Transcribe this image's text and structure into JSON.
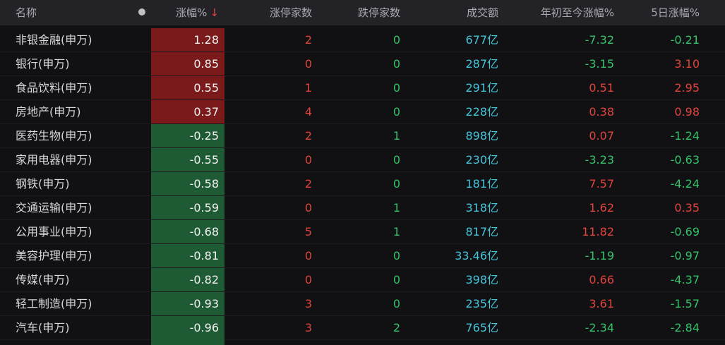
{
  "header": {
    "name": "名称",
    "pct": "涨幅%",
    "sort_arrow": "↓",
    "up_count": "涨停家数",
    "down_count": "跌停家数",
    "volume": "成交额",
    "ytd": "年初至今涨幅%",
    "five_day": "5日涨幅%"
  },
  "colors": {
    "up": "#e0443d",
    "down": "#35c26a",
    "volume": "#45c4da",
    "pos_cell_bg": "#7a1a1a",
    "neg_cell_bg": "#1e5a33"
  },
  "rows": [
    {
      "name": "非银金融(申万)",
      "pct": "1.28",
      "up": "2",
      "down": "0",
      "vol": "677亿",
      "ytd": "-7.32",
      "d5": "-0.21"
    },
    {
      "name": "银行(申万)",
      "pct": "0.85",
      "up": "0",
      "down": "0",
      "vol": "287亿",
      "ytd": "-3.15",
      "d5": "3.10"
    },
    {
      "name": "食品饮料(申万)",
      "pct": "0.55",
      "up": "1",
      "down": "0",
      "vol": "291亿",
      "ytd": "0.51",
      "d5": "2.95"
    },
    {
      "name": "房地产(申万)",
      "pct": "0.37",
      "up": "4",
      "down": "0",
      "vol": "228亿",
      "ytd": "0.38",
      "d5": "0.98"
    },
    {
      "name": "医药生物(申万)",
      "pct": "-0.25",
      "up": "2",
      "down": "1",
      "vol": "898亿",
      "ytd": "0.07",
      "d5": "-1.24"
    },
    {
      "name": "家用电器(申万)",
      "pct": "-0.55",
      "up": "0",
      "down": "0",
      "vol": "230亿",
      "ytd": "-3.23",
      "d5": "-0.63"
    },
    {
      "name": "钢铁(申万)",
      "pct": "-0.58",
      "up": "2",
      "down": "0",
      "vol": "181亿",
      "ytd": "7.57",
      "d5": "-4.24"
    },
    {
      "name": "交通运输(申万)",
      "pct": "-0.59",
      "up": "0",
      "down": "1",
      "vol": "318亿",
      "ytd": "1.62",
      "d5": "0.35"
    },
    {
      "name": "公用事业(申万)",
      "pct": "-0.68",
      "up": "5",
      "down": "1",
      "vol": "817亿",
      "ytd": "11.82",
      "d5": "-0.69"
    },
    {
      "name": "美容护理(申万)",
      "pct": "-0.81",
      "up": "0",
      "down": "0",
      "vol": "33.46亿",
      "ytd": "-1.19",
      "d5": "-0.97"
    },
    {
      "name": "传媒(申万)",
      "pct": "-0.82",
      "up": "0",
      "down": "0",
      "vol": "398亿",
      "ytd": "0.66",
      "d5": "-4.37"
    },
    {
      "name": "轻工制造(申万)",
      "pct": "-0.93",
      "up": "3",
      "down": "0",
      "vol": "235亿",
      "ytd": "3.61",
      "d5": "-1.57"
    },
    {
      "name": "汽车(申万)",
      "pct": "-0.96",
      "up": "3",
      "down": "2",
      "vol": "765亿",
      "ytd": "-2.34",
      "d5": "-2.84"
    }
  ]
}
